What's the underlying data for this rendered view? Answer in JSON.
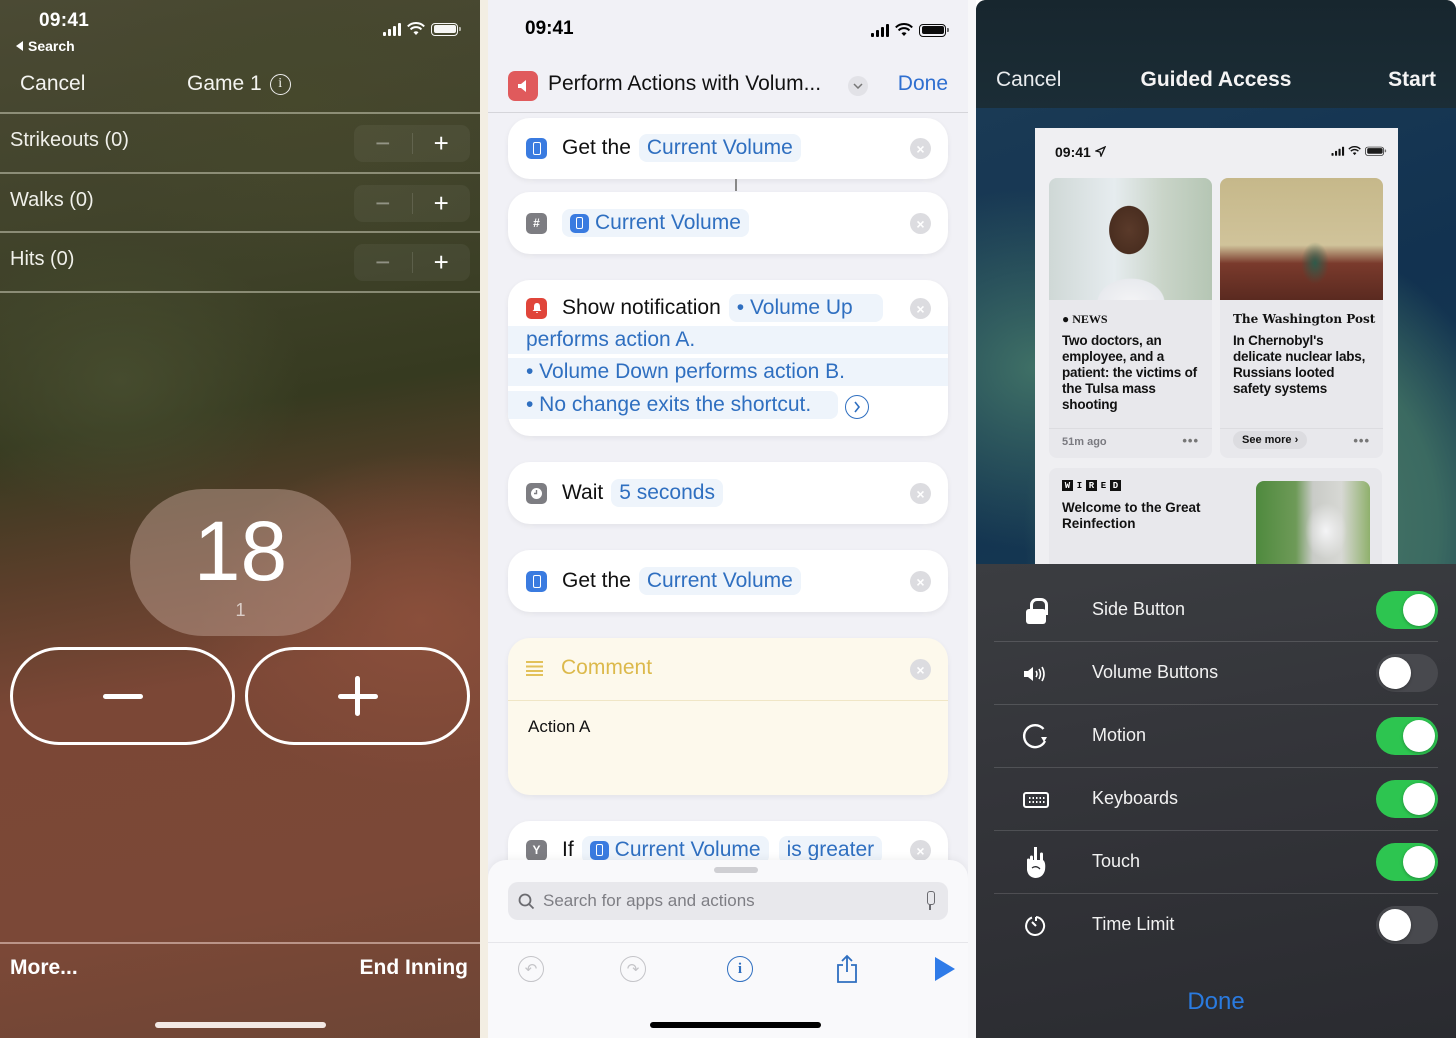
{
  "panel_counter": {
    "status": {
      "time": "09:41",
      "back_label": "Search"
    },
    "nav": {
      "cancel": "Cancel",
      "title": "Game 1"
    },
    "stats": [
      {
        "label": "Strikeouts (0)"
      },
      {
        "label": "Walks (0)"
      },
      {
        "label": "Hits (0)"
      }
    ],
    "stepper": {
      "minus": "−",
      "plus": "+"
    },
    "counter": {
      "value": "18",
      "sub_value": "1"
    },
    "footer": {
      "more": "More...",
      "end_inning": "End Inning"
    },
    "colors": {
      "bg_green": "#3e4128",
      "bg_rust": "#7b4836"
    }
  },
  "panel_shortcuts": {
    "status": {
      "time": "09:41"
    },
    "header": {
      "title": "Perform Actions with Volum...",
      "done": "Done",
      "icon": "speaker-icon",
      "accent": "#2f6fd0"
    },
    "actions": [
      {
        "icon": "phone-icon",
        "verb": "Get the",
        "token": "Current Volume"
      },
      {
        "icon": "number-icon",
        "icon_text": "#",
        "token": "Current Volume"
      },
      {
        "icon": "notification-icon",
        "verb": "Show notification",
        "token_lines": [
          "• Volume Up",
          "performs action A.",
          "• Volume Down performs action B.",
          "• No change exits the shortcut."
        ]
      },
      {
        "icon": "clock-icon",
        "verb": "Wait",
        "token": "5 seconds"
      },
      {
        "icon": "phone-icon",
        "verb": "Get the",
        "token": "Current Volume"
      },
      {
        "icon": "comment-icon",
        "verb": "Comment",
        "body": "Action A"
      },
      {
        "icon": "branch-icon",
        "icon_text": "Y",
        "verb": "If",
        "token": "Current Volume",
        "token2": "is greater"
      }
    ],
    "search": {
      "placeholder": "Search for apps and actions"
    },
    "toolbar": {
      "undo": "↶",
      "redo": "↷",
      "info": "i"
    }
  },
  "panel_guided_access": {
    "nav": {
      "cancel": "Cancel",
      "title": "Guided Access",
      "start": "Start"
    },
    "preview": {
      "time": "09:41",
      "cards": [
        {
          "source": "NEWS",
          "headline": "Two doctors, an employee, and a patient: the victims of the Tulsa mass shooting",
          "meta": "51m ago"
        },
        {
          "source": "The Washington Post",
          "headline": "In Chernobyl's delicate nuclear labs, Russians looted safety systems",
          "action": "See more ›"
        }
      ],
      "wired": {
        "logo": [
          "W",
          "I",
          "R",
          "E",
          "D"
        ],
        "headline": "Welcome to the Great Reinfection"
      }
    },
    "options": [
      {
        "label": "Side Button",
        "icon": "lock-icon",
        "on": true
      },
      {
        "label": "Volume Buttons",
        "icon": "speaker-icon",
        "on": false
      },
      {
        "label": "Motion",
        "icon": "rotate-icon",
        "on": true
      },
      {
        "label": "Keyboards",
        "icon": "keyboard-icon",
        "on": true
      },
      {
        "label": "Touch",
        "icon": "hand-icon",
        "on": true
      },
      {
        "label": "Time Limit",
        "icon": "timer-icon",
        "on": false
      }
    ],
    "done": "Done",
    "colors": {
      "toggle_on": "#2dc550",
      "toggle_off": "#48494e",
      "done": "#2a7be0"
    }
  }
}
